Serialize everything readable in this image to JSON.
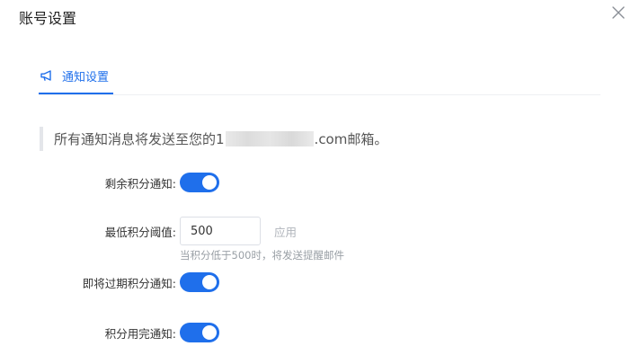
{
  "dialog": {
    "title": "账号设置",
    "close_icon": "close-icon"
  },
  "tabs": [
    {
      "label": "通知设置",
      "icon": "megaphone-icon",
      "active": true
    }
  ],
  "notice": {
    "prefix": "所有通知消息将发送至您的1",
    "suffix": ".com邮箱。"
  },
  "settings": {
    "remaining_points": {
      "label": "剩余积分通知:",
      "enabled": true
    },
    "threshold": {
      "label": "最低积分阈值:",
      "value": "500",
      "apply_label": "应用",
      "hint": "当积分低于500时，将发送提醒邮件"
    },
    "expiring_points": {
      "label": "即将过期积分通知:",
      "enabled": true
    },
    "used_up": {
      "label": "积分用完通知:",
      "enabled": true
    }
  },
  "colors": {
    "accent": "#1f6feb",
    "muted": "#9aa0a6",
    "border": "#dcdfe6"
  }
}
